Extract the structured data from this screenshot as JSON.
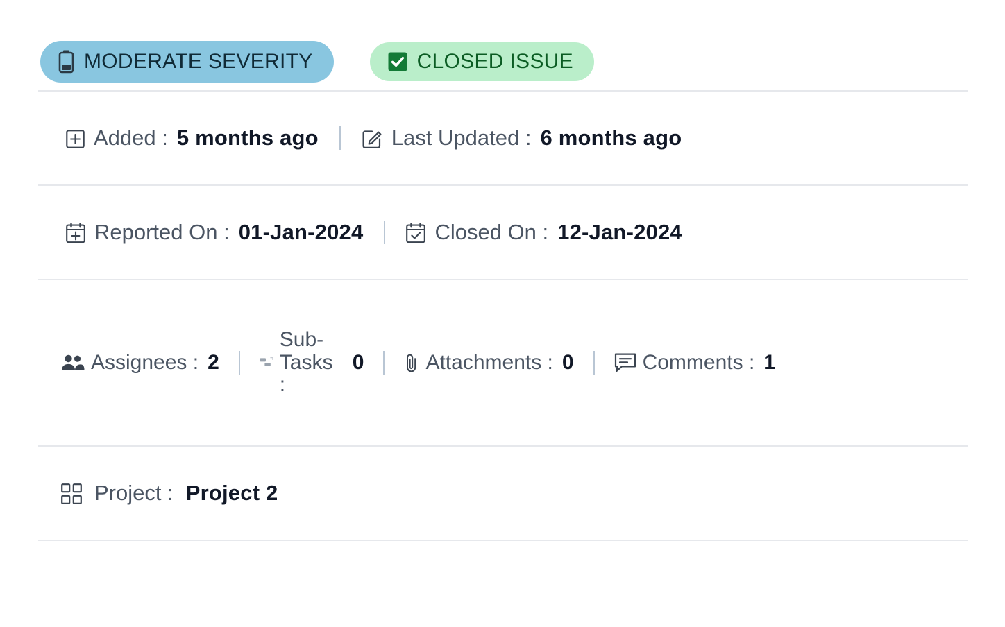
{
  "badges": [
    {
      "id": "severity",
      "label": "MODERATE SEVERITY",
      "icon": "battery-half-icon",
      "background": "#89c6e0",
      "text_color": "#102a36"
    },
    {
      "id": "status",
      "label": "CLOSED ISSUE",
      "icon": "check-square-icon",
      "background": "#baeeca",
      "text_color": "#0b5c23"
    }
  ],
  "dates_row": {
    "added": {
      "icon": "square-plus-icon",
      "label": "Added :",
      "value": "5 months ago"
    },
    "last_updated": {
      "icon": "pencil-square-icon",
      "label": "Last Updated :",
      "value": "6 months ago"
    }
  },
  "reported_row": {
    "reported_on": {
      "icon": "calendar-plus-icon",
      "label": "Reported On :",
      "value": "01-Jan-2024"
    },
    "closed_on": {
      "icon": "calendar-check-icon",
      "label": "Closed On :",
      "value": "12-Jan-2024"
    }
  },
  "stats": [
    {
      "id": "assignees",
      "icon": "users-icon",
      "label": "Assignees :",
      "count": "2"
    },
    {
      "id": "subtasks",
      "icon": "subtasks-icon",
      "label": "Sub-Tasks :",
      "count": "0"
    },
    {
      "id": "attachments",
      "icon": "paperclip-icon",
      "label": "Attachments :",
      "count": "0"
    },
    {
      "id": "comments",
      "icon": "comment-icon",
      "label": "Comments :",
      "count": "1"
    }
  ],
  "project": {
    "icon": "grid-squares-icon",
    "label": "Project :",
    "value": "Project 2"
  },
  "colors": {
    "divider": "#e6e8ec",
    "pipe": "#b9c6d4",
    "label_text": "#4b5563",
    "value_text": "#111827"
  }
}
